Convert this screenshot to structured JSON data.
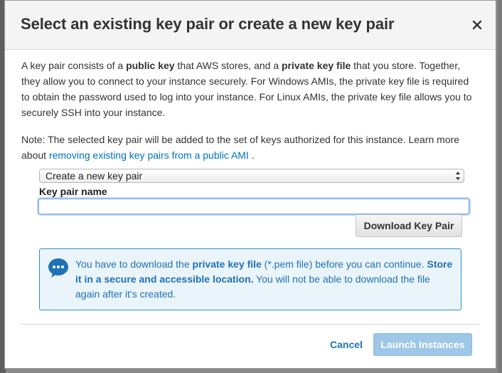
{
  "dialog": {
    "title": "Select an existing key pair or create a new key pair",
    "close_icon": "close-icon"
  },
  "description": {
    "segments": [
      {
        "text": "A key pair consists of a ",
        "bold": false
      },
      {
        "text": "public key",
        "bold": true
      },
      {
        "text": " that AWS stores, and a ",
        "bold": false
      },
      {
        "text": "private key file",
        "bold": true
      },
      {
        "text": " that you store. Together, they allow you to connect to your instance securely. For Windows AMIs, the private key file is required to obtain the password used to log into your instance. For Linux AMIs, the private key file allows you to securely SSH into your instance.",
        "bold": false
      }
    ]
  },
  "note": {
    "prefix": "Note: The selected key pair will be added to the set of keys authorized for this instance. Learn more about ",
    "link_text": "removing existing key pairs from a public AMI",
    "suffix": " ."
  },
  "key_pair_select": {
    "selected": "Create a new key pair"
  },
  "key_pair_name": {
    "label": "Key pair name",
    "value": "",
    "placeholder": ""
  },
  "download_button": {
    "label": "Download Key Pair"
  },
  "info_box": {
    "icon": "chat-bubble-icon",
    "segments": [
      {
        "text": "You have to download the ",
        "bold": false
      },
      {
        "text": "private key file",
        "bold": true
      },
      {
        "text": " (*.pem file) before you can continue. ",
        "bold": false
      },
      {
        "text": "Store it in a secure and accessible location.",
        "bold": true
      },
      {
        "text": " You will not be able to download the file again after it's created.",
        "bold": false
      }
    ]
  },
  "footer": {
    "cancel_label": "Cancel",
    "launch_label": "Launch Instances"
  },
  "colors": {
    "accent": "#1f72b4",
    "link": "#0073bb",
    "info_border": "#2f8ecb",
    "info_bg": "#eaf4fb",
    "launch_disabled": "#9ec7e8"
  }
}
